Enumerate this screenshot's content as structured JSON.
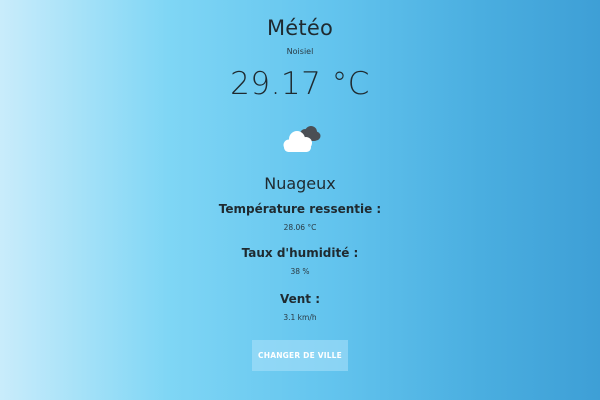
{
  "app": {
    "title": "Météo",
    "city": "Noisiel",
    "temperature": "29.17 °C",
    "weather_icon": "cloud-icon",
    "description": "Nuageux"
  },
  "details": {
    "feels_like_label": "Température ressentie :",
    "feels_like_value": "28.06 °C",
    "humidity_label": "Taux d'humidité :",
    "humidity_value": "38 %",
    "wind_label": "Vent :",
    "wind_value": "3.1 km/h"
  },
  "actions": {
    "change_city_label": "CHANGER DE VILLE"
  },
  "colors": {
    "gradient_left": "#c9ecfb",
    "gradient_right": "#3e9fd6",
    "text": "#1f2a30"
  }
}
